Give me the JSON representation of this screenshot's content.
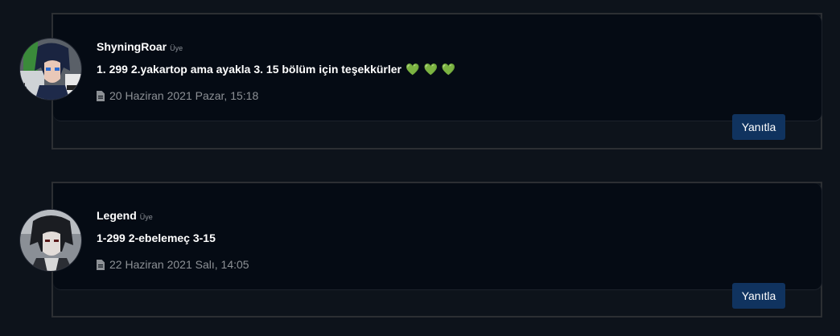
{
  "comments": [
    {
      "username": "ShyningRoar",
      "role": "Üye",
      "message": "1. 299 2.yakartop ama ayakla 3. 15 bölüm için teşekkürler",
      "hearts": [
        "💚",
        "💚",
        "💚"
      ],
      "date": "20 Haziran 2021 Pazar, 15:18",
      "reply_label": "Yanıtla",
      "avatar_icon": "anime-avatar-blue-hair"
    },
    {
      "username": "Legend",
      "role": "Üye",
      "message": "1-299 2-ebelemeç 3-15",
      "hearts": [],
      "date": "22 Haziran 2021 Salı, 14:05",
      "reply_label": "Yanıtla",
      "avatar_icon": "anime-avatar-dark-hair"
    }
  ],
  "colors": {
    "background": "#0d131b",
    "card": "#050b14",
    "button": "#10335f",
    "heart": "#3ec22a"
  }
}
